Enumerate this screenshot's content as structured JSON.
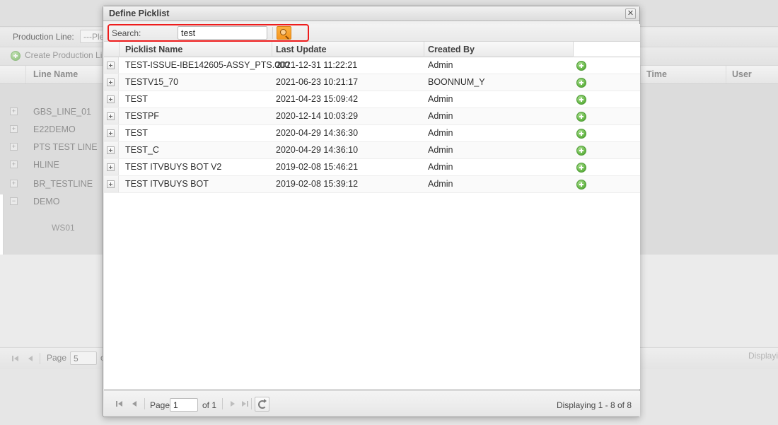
{
  "background": {
    "toolbar": {
      "production_line_label": "Production Line:",
      "production_line_value": "---Plea"
    },
    "create_button_label": "Create Production Line",
    "grid": {
      "columns": [
        "Line Name",
        "Time",
        "User"
      ],
      "rows": [
        {
          "name": "GBS_LINE_01"
        },
        {
          "name": "E22DEMO"
        },
        {
          "name": "PTS TEST LINE"
        },
        {
          "name": "HLINE"
        },
        {
          "name": "BR_TESTLINE"
        },
        {
          "name": "DEMO"
        }
      ],
      "child_row": "WS01"
    },
    "footer": {
      "page_label": "Page",
      "page_value": "5",
      "of_label": "of",
      "displaying": "Displayi"
    }
  },
  "dialog": {
    "title": "Define Picklist",
    "close_icon": "close-icon",
    "search": {
      "label": "Search:",
      "value": "test",
      "placeholder": "",
      "button_icon": "search-icon"
    },
    "grid": {
      "columns": [
        "Picklist Name",
        "Last Update",
        "Created By",
        ""
      ],
      "rows": [
        {
          "name": "TEST-ISSUE-IBE142605-ASSY_PTS.000",
          "last_update": "2021-12-31 11:22:21",
          "created_by": "Admin",
          "action_icon": "add-circle-icon"
        },
        {
          "name": "TESTV15_70",
          "last_update": "2021-06-23 10:21:17",
          "created_by": "BOONNUM_Y",
          "action_icon": "add-circle-icon"
        },
        {
          "name": "TEST",
          "last_update": "2021-04-23 15:09:42",
          "created_by": "Admin",
          "action_icon": "add-circle-icon"
        },
        {
          "name": "TESTPF",
          "last_update": "2020-12-14 10:03:29",
          "created_by": "Admin",
          "action_icon": "add-circle-icon"
        },
        {
          "name": "TEST",
          "last_update": "2020-04-29 14:36:30",
          "created_by": "Admin",
          "action_icon": "add-circle-icon"
        },
        {
          "name": "TEST_C",
          "last_update": "2020-04-29 14:36:10",
          "created_by": "Admin",
          "action_icon": "add-circle-icon"
        },
        {
          "name": "TEST ITVBUYS BOT V2",
          "last_update": "2019-02-08 15:46:21",
          "created_by": "Admin",
          "action_icon": "add-circle-icon"
        },
        {
          "name": "TEST ITVBUYS BOT",
          "last_update": "2019-02-08 15:39:12",
          "created_by": "Admin",
          "action_icon": "add-circle-icon"
        }
      ]
    },
    "footer": {
      "first_label": "first-page-icon",
      "prev_label": "prev-page-icon",
      "page_label": "Page",
      "page_value": "1",
      "of_label": "of 1",
      "next_label": "next-page-icon",
      "last_label": "last-page-icon",
      "refresh_label": "refresh-icon",
      "displaying": "Displaying 1 - 8 of 8"
    }
  },
  "colors": {
    "accent_red": "#ee1c1c",
    "search_button": "#f5961e",
    "action_green": "#62b442"
  }
}
